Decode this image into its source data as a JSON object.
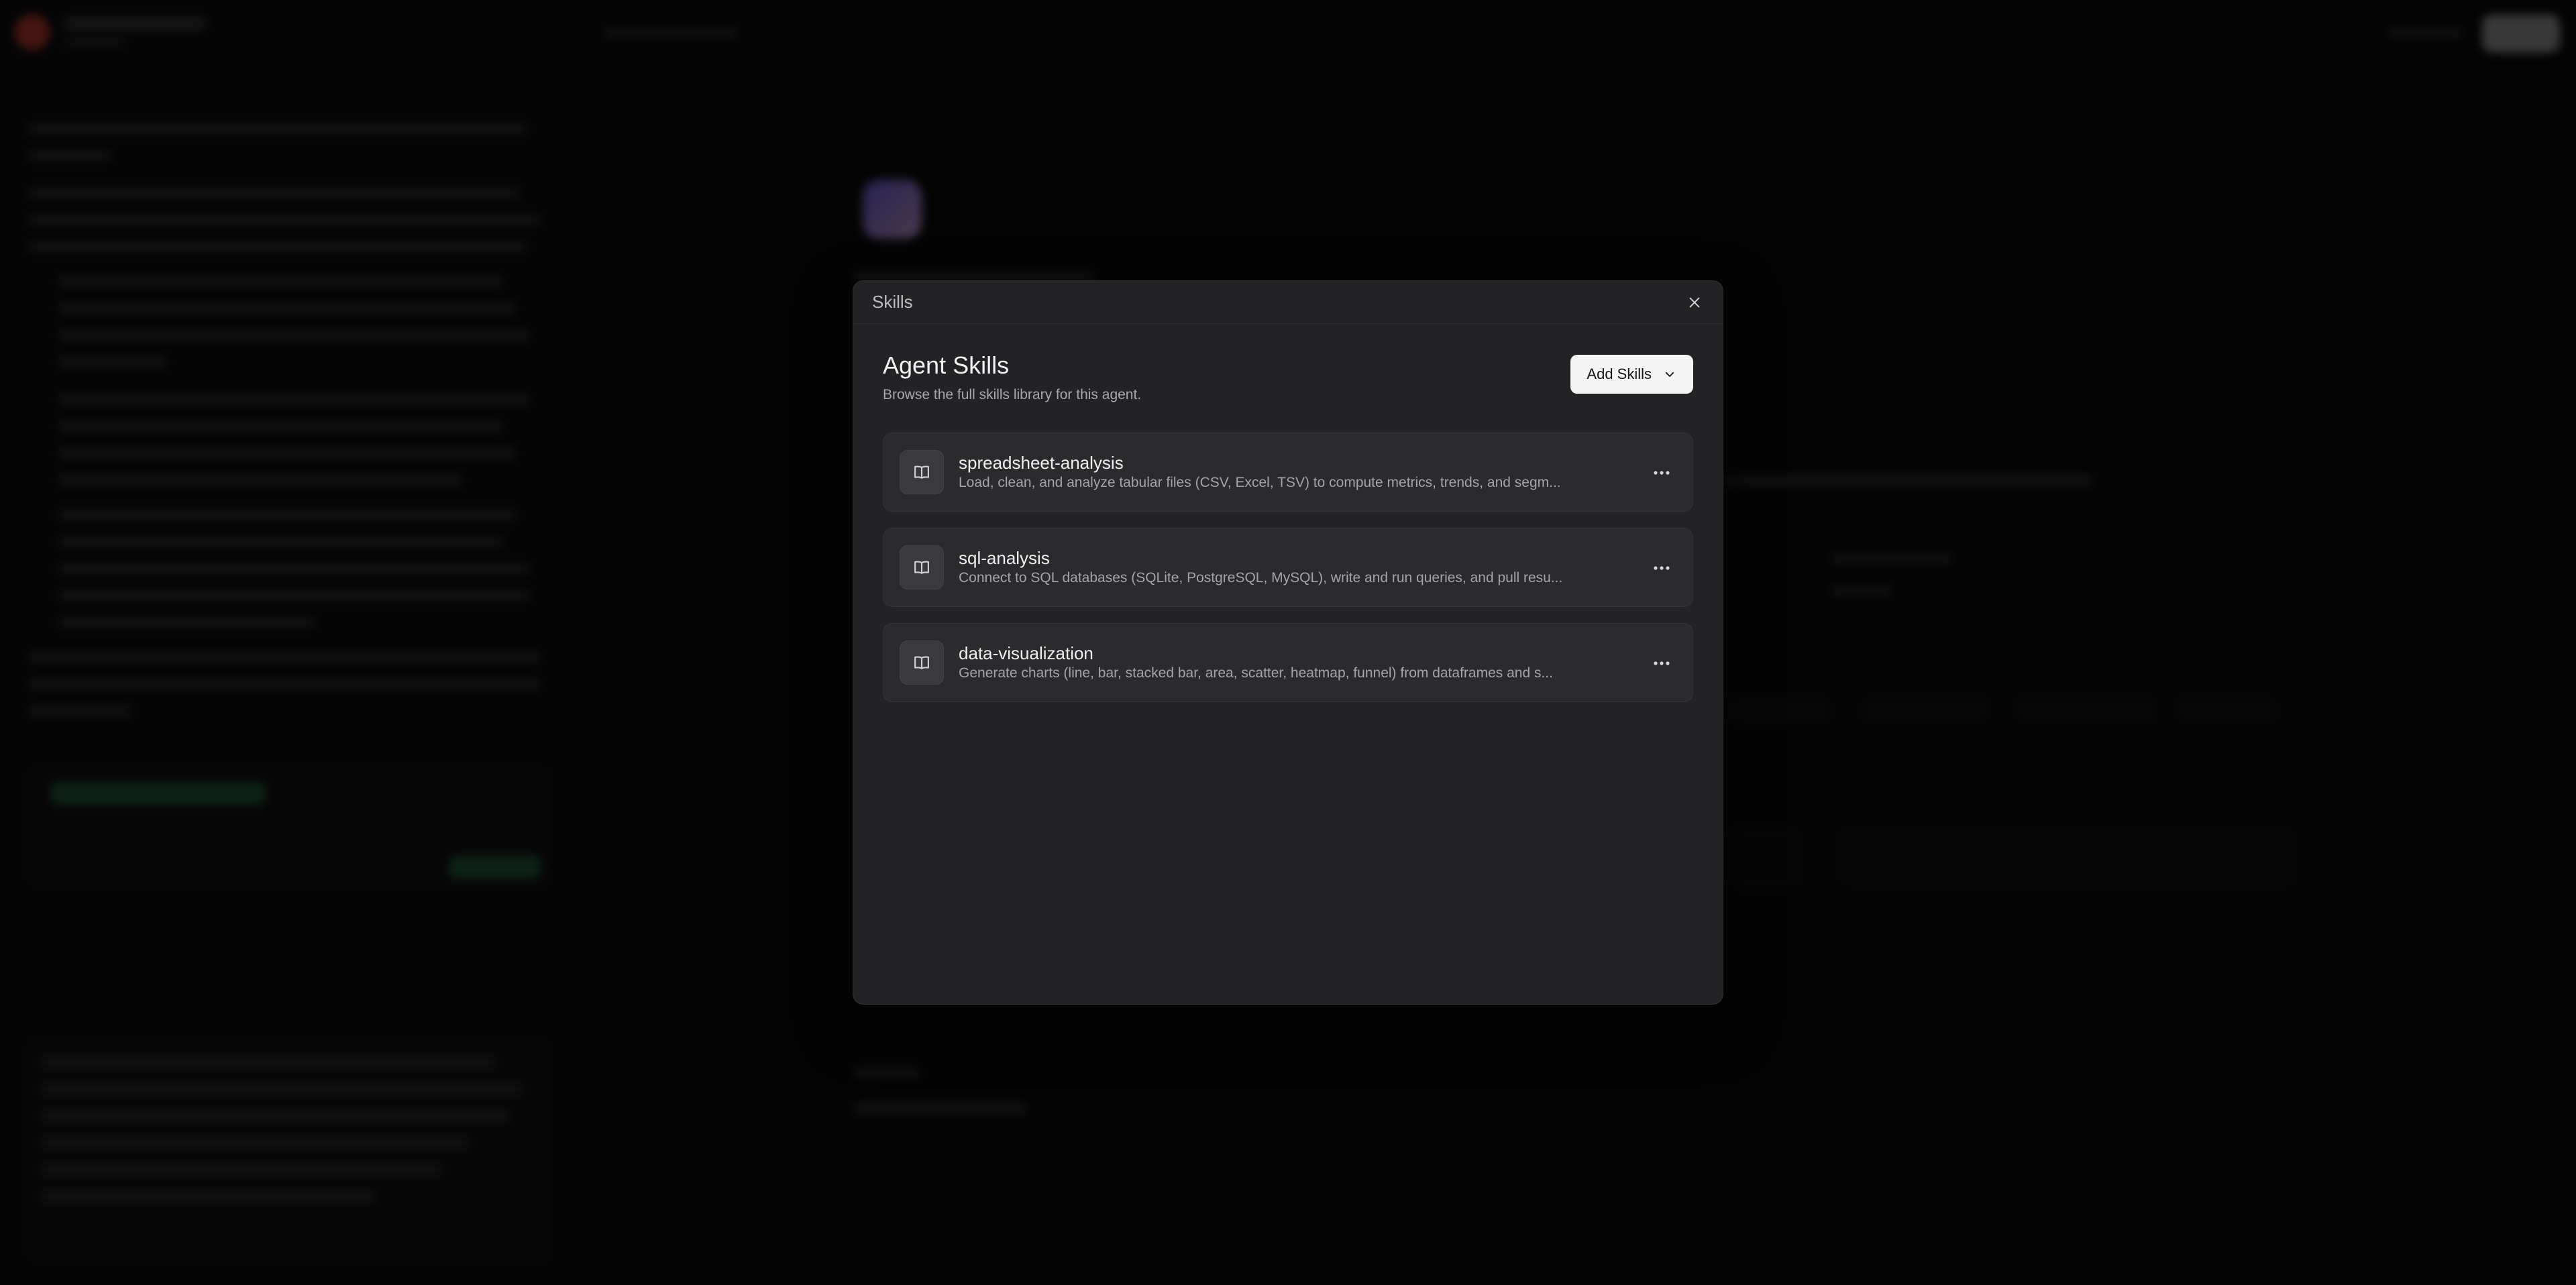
{
  "modal": {
    "header_title": "Skills",
    "section_title": "Agent Skills",
    "section_subtitle": "Browse the full skills library for this agent.",
    "add_skills_label": "Add Skills",
    "skills": [
      {
        "name": "spreadsheet-analysis",
        "description": "Load, clean, and analyze tabular files (CSV, Excel, TSV) to compute metrics, trends, and segm..."
      },
      {
        "name": "sql-analysis",
        "description": "Connect to SQL databases (SQLite, PostgreSQL, MySQL), write and run queries, and pull resu..."
      },
      {
        "name": "data-visualization",
        "description": "Generate charts (line, bar, stacked bar, area, scatter, heatmap, funnel) from dataframes and s..."
      }
    ]
  },
  "icons": {
    "close": "close-icon",
    "chevron": "chevron-down-icon",
    "skill": "book-open-icon",
    "more": "more-horizontal-icon"
  },
  "colors": {
    "modal_bg": "#232325",
    "card_bg": "#2b2b2d",
    "primary_button_bg": "#f4f4f5",
    "text_primary": "#efeff1",
    "text_secondary": "#a4a4a9"
  }
}
